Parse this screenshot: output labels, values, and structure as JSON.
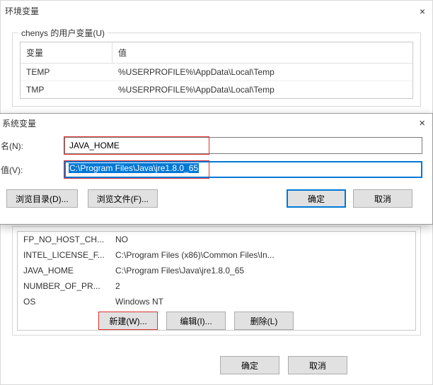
{
  "mainWindow": {
    "title": "环境变量",
    "closeGlyph": "×"
  },
  "userVars": {
    "group_title": "chenys 的用户变量(U)",
    "header_name": "变量",
    "header_value": "值",
    "rows": [
      {
        "name": "TEMP",
        "value": "%USERPROFILE%\\AppData\\Local\\Temp"
      },
      {
        "name": "TMP",
        "value": "%USERPROFILE%\\AppData\\Local\\Temp"
      }
    ]
  },
  "sysVars": {
    "rows": [
      {
        "name": "FP_NO_HOST_CH...",
        "value": "NO"
      },
      {
        "name": "INTEL_LICENSE_F...",
        "value": "C:\\Program Files (x86)\\Common Files\\In..."
      },
      {
        "name": "JAVA_HOME",
        "value": "C:\\Program Files\\Java\\jre1.8.0_65"
      },
      {
        "name": "NUMBER_OF_PR...",
        "value": "2"
      },
      {
        "name": "OS",
        "value": "Windows NT"
      }
    ],
    "btn_new": "新建(W)...",
    "btn_edit": "编辑(I)...",
    "btn_delete": "删除(L)"
  },
  "bottom": {
    "ok": "确定",
    "cancel": "取消"
  },
  "modal": {
    "title": "系统变量",
    "closeGlyph": "×",
    "name_label": "名(N):",
    "name_value": "JAVA_HOME",
    "value_label": "值(V):",
    "value_value": "C:\\Program Files\\Java\\jre1.8.0_65",
    "browse_dir": "浏览目录(D)...",
    "browse_file": "浏览文件(F)...",
    "ok": "确定",
    "cancel": "取消"
  }
}
